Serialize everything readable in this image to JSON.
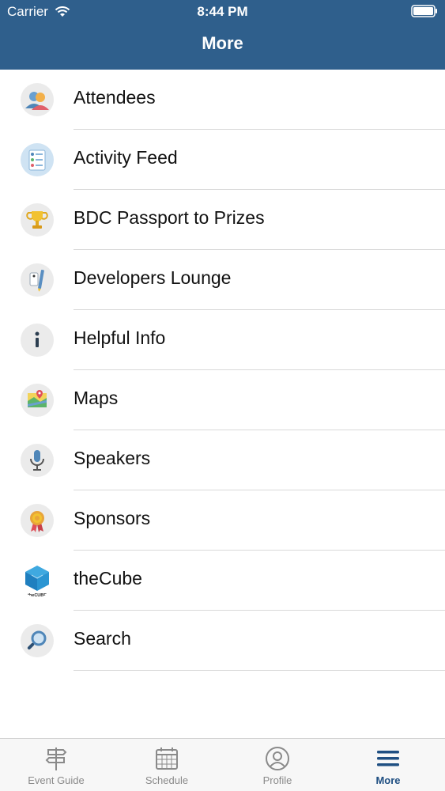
{
  "status_bar": {
    "carrier": "Carrier",
    "time": "8:44 PM"
  },
  "nav": {
    "title": "More"
  },
  "menu": {
    "items": [
      {
        "label": "Attendees",
        "icon": "attendees-icon"
      },
      {
        "label": "Activity Feed",
        "icon": "activity-feed-icon"
      },
      {
        "label": "BDC Passport to Prizes",
        "icon": "trophy-icon"
      },
      {
        "label": "Developers Lounge",
        "icon": "developers-lounge-icon"
      },
      {
        "label": "Helpful Info",
        "icon": "info-icon"
      },
      {
        "label": "Maps",
        "icon": "map-icon"
      },
      {
        "label": "Speakers",
        "icon": "microphone-icon"
      },
      {
        "label": "Sponsors",
        "icon": "ribbon-award-icon"
      },
      {
        "label": "theCube",
        "icon": "thecube-logo-icon",
        "logo_text": "theCUBE"
      },
      {
        "label": "Search",
        "icon": "magnifier-icon"
      }
    ]
  },
  "tabs": [
    {
      "label": "Event Guide",
      "icon": "signpost-icon"
    },
    {
      "label": "Schedule",
      "icon": "calendar-icon"
    },
    {
      "label": "Profile",
      "icon": "profile-icon"
    },
    {
      "label": "More",
      "icon": "hamburger-icon",
      "active": true
    }
  ],
  "colors": {
    "header": "#2f5f8c",
    "active_tab": "#1f4f82",
    "inactive_tab": "#8a8a8a"
  }
}
